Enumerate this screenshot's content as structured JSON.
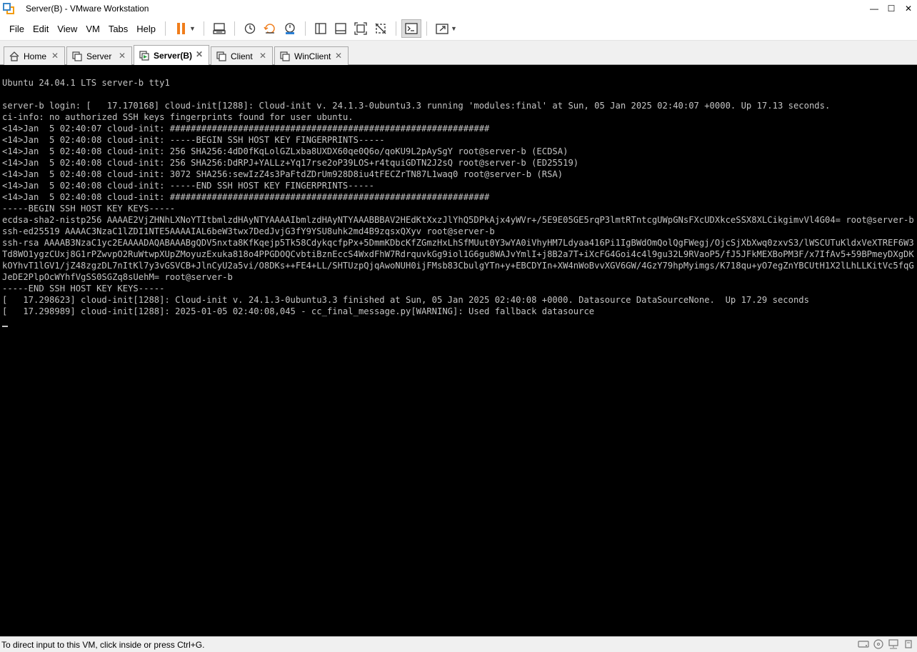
{
  "window": {
    "title": "Server(B) - VMware Workstation",
    "controls": {
      "minimize": "—",
      "maximize": "☐",
      "close": "✕"
    }
  },
  "menu": {
    "items": [
      "File",
      "Edit",
      "View",
      "VM",
      "Tabs",
      "Help"
    ]
  },
  "toolbar": {
    "icons": [
      "pause-icon",
      "send-ctrl-alt-del-icon",
      "snapshot-icon",
      "revert-snapshot-icon",
      "snapshot-manager-icon",
      "library-icon",
      "thumbnail-icon",
      "fullscreen-icon",
      "unity-icon",
      "console-view-icon",
      "stretch-icon"
    ],
    "accent_color": "#f07d1b"
  },
  "tabs": [
    {
      "label": "Home",
      "icon": "home-icon",
      "active": false
    },
    {
      "label": "Server",
      "icon": "vm-icon",
      "active": false
    },
    {
      "label": "Server(B)",
      "icon": "vm-running-icon",
      "active": true
    },
    {
      "label": "Client",
      "icon": "vm-icon",
      "active": false
    },
    {
      "label": "WinClient",
      "icon": "vm-icon",
      "active": false
    }
  ],
  "console": {
    "lines": [
      "Ubuntu 24.04.1 LTS server-b tty1",
      "",
      "server-b login: [   17.170168] cloud-init[1288]: Cloud-init v. 24.1.3-0ubuntu3.3 running 'modules:final' at Sun, 05 Jan 2025 02:40:07 +0000. Up 17.13 seconds.",
      "ci-info: no authorized SSH keys fingerprints found for user ubuntu.",
      "<14>Jan  5 02:40:07 cloud-init: #############################################################",
      "<14>Jan  5 02:40:08 cloud-init: -----BEGIN SSH HOST KEY FINGERPRINTS-----",
      "<14>Jan  5 02:40:08 cloud-init: 256 SHA256:4dD0fKqLolGZLxba8UXDX60qe0Q6o/qoKU9L2pAySgY root@server-b (ECDSA)",
      "<14>Jan  5 02:40:08 cloud-init: 256 SHA256:DdRPJ+YALLz+Yq17rse2oP39LOS+r4tquiGDTN2J2sQ root@server-b (ED25519)",
      "<14>Jan  5 02:40:08 cloud-init: 3072 SHA256:sewIzZ4s3PaFtdZDrUm928D8iu4tFECZrTN87L1waq0 root@server-b (RSA)",
      "<14>Jan  5 02:40:08 cloud-init: -----END SSH HOST KEY FINGERPRINTS-----",
      "<14>Jan  5 02:40:08 cloud-init: #############################################################",
      "-----BEGIN SSH HOST KEY KEYS-----",
      "ecdsa-sha2-nistp256 AAAAE2VjZHNhLXNoYTItbmlzdHAyNTYAAAAIbmlzdHAyNTYAAABBBAV2HEdKtXxzJlYhQ5DPkAjx4yWVr+/5E9E05GE5rqP3lmtRTntcgUWpGNsFXcUDXkceSSX8XLCikgimvVl4G04= root@server-b",
      "ssh-ed25519 AAAAC3NzaC1lZDI1NTE5AAAAIAL6beW3twx7DedJvjG3fY9YSU8uhk2md4B9zqsxQXyv root@server-b",
      "ssh-rsa AAAAB3NzaC1yc2EAAAADAQABAAABgQDV5nxta8KfKqejp5Tk58CdykqcfpPx+5DmmKDbcKfZGmzHxLhSfMUut0Y3wYA0iVhyHM7Ldyaa416Pi1IgBWdOmQolQgFWegj/OjcSjXbXwq0zxvS3/lWSCUTuKldxVeXTREF6W3Td8WO1ygzCUxj8G1rPZwvpO2RuWtwpXUpZMoyuzExuka818o4PPGDOQCvbtiBznEccS4WxdFhW7RdrquvkGg9iol1G6gu8WAJvYmlI+j8B2a7T+iXcFG4Goi4c4l9gu32L9RVaoP5/fJ5JFkMEXBoPM3F/x7IfAv5+59BPmeyDXgDKkOYhvT1lGV1/jZ48zgzDL7nItKl7y3vGSVCB+JlnCyU2a5vi/O8DKs++FE4+LL/SHTUzpQjqAwoNUH0ijFMsb83CbulgYTn+y+EBCDYIn+XW4nWoBvvXGV6GW/4GzY79hpMyimgs/K718qu+yO7egZnYBCUtH1X2lLhLLKitVc5fqGJeDE2PlpOcWYhfVgSS0SGZq8sUehM= root@server-b",
      "-----END SSH HOST KEY KEYS-----",
      "[   17.298623] cloud-init[1288]: Cloud-init v. 24.1.3-0ubuntu3.3 finished at Sun, 05 Jan 2025 02:40:08 +0000. Datasource DataSourceNone.  Up 17.29 seconds",
      "[   17.298989] cloud-init[1288]: 2025-01-05 02:40:08,045 - cc_final_message.py[WARNING]: Used fallback datasource"
    ],
    "text_color": "#c4c4c4",
    "background": "#000000"
  },
  "statusbar": {
    "message": "To direct input to this VM, click inside or press Ctrl+G.",
    "icons": [
      "hard-disk-icon",
      "cd-icon",
      "network-icon",
      "usb-icon"
    ]
  }
}
